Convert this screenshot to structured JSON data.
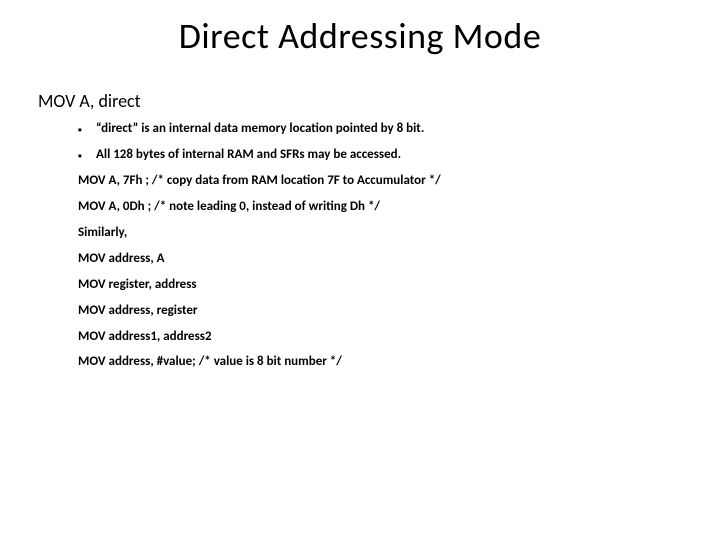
{
  "title": "Direct Addressing Mode",
  "subheading": "MOV A, direct",
  "lines": {
    "l0": "“direct” is an internal data memory location pointed by 8 bit.",
    "l1": "All 128 bytes of internal RAM and SFRs may be accessed.",
    "l2": "MOV A, 7Fh ; /* copy data from RAM location 7F to Accumulator */",
    "l3": "MOV A, 0Dh ;  /* note leading 0, instead of writing Dh */",
    "l4": "Similarly,",
    "l5": "MOV address, A",
    "l6": "MOV register, address",
    "l7": "MOV address, register",
    "l8": "MOV address1, address2",
    "l9": "MOV address, #value;  /* value is 8 bit number */"
  }
}
